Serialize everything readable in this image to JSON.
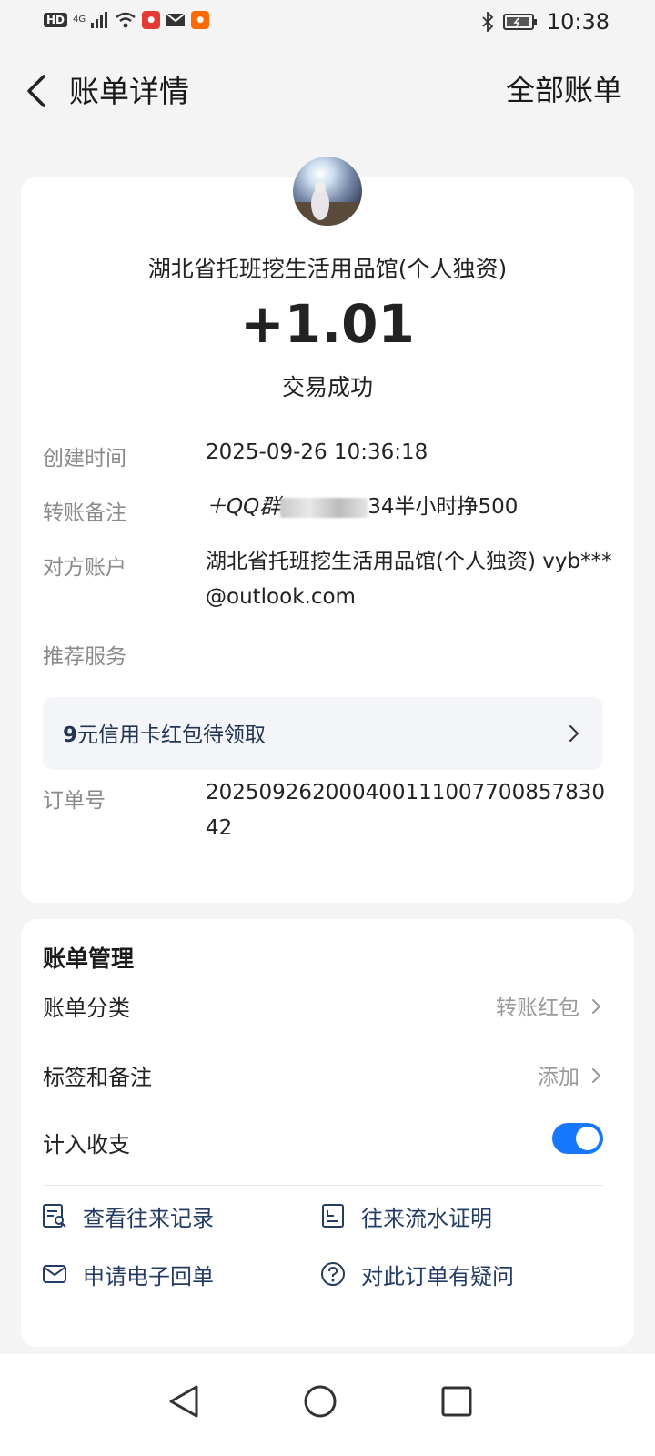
{
  "status_bar": {
    "left_badge": "HD",
    "network": "4G",
    "time": "10:38"
  },
  "header": {
    "title": "账单详情",
    "right_link": "全部账单"
  },
  "transaction": {
    "merchant_name": "湖北省托班挖生活用品馆(个人独资)",
    "amount": "+1.01",
    "status": "交易成功"
  },
  "details": {
    "created_label": "创建时间",
    "created_value": "2025-09-26 10:36:18",
    "memo_label": "转账备注",
    "memo_prefix": "＋QQ群",
    "memo_suffix": "34半小时挣500",
    "account_label": "对方账户",
    "account_value": "湖北省托班挖生活用品馆(个人独资) vyb***@outlook.com",
    "recommend_label": "推荐服务",
    "order_label": "订单号",
    "order_value": "20250926200040011100770085783042"
  },
  "promo": {
    "amount_text": "9",
    "text": "元信用卡红包待领取"
  },
  "management": {
    "title": "账单管理",
    "category_label": "账单分类",
    "category_value": "转账红包",
    "tag_label": "标签和备注",
    "tag_value": "添加",
    "include_label": "计入收支",
    "include_enabled": true,
    "links": {
      "history": "查看往来记录",
      "statement": "往来流水证明",
      "receipt": "申请电子回单",
      "question": "对此订单有疑问"
    }
  },
  "colors": {
    "accent": "#1677ff",
    "link_text": "#243b63",
    "page_bg": "#f4f4f4"
  }
}
